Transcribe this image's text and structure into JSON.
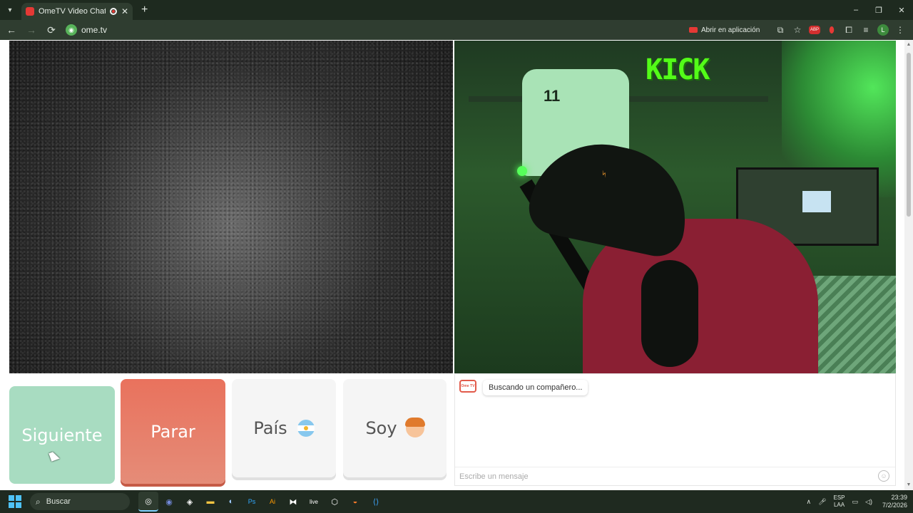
{
  "browser": {
    "tab_title": "OmeTV Video Chat — Ome",
    "tab_close": "✕",
    "new_tab": "+",
    "url": "ome.tv",
    "open_in_app": "Abrir en aplicación",
    "profile_initial": "L",
    "nav": {
      "back": "←",
      "forward": "→",
      "reload": "⟳"
    },
    "window_controls": {
      "minimize": "–",
      "restore": "❐",
      "close": "✕"
    }
  },
  "video": {
    "stream_logo_text": "KICK",
    "jersey_number": "11"
  },
  "controls": {
    "next_label": "Siguiente",
    "stop_label": "Parar",
    "country_label": "País",
    "gender_label": "Soy"
  },
  "chat": {
    "logo_text": "Ome TV",
    "status_message": "Buscando un compañero...",
    "input_placeholder": "Escribe un mensaje"
  },
  "taskbar": {
    "search_label": "Buscar",
    "language": "ESP",
    "language_sub": "LAA",
    "time": "23:39",
    "date": "7/2/2026"
  },
  "colors": {
    "next_button": "#a8dcc1",
    "stop_button": "#e9725d",
    "browser_chrome": "#2f3d30"
  }
}
